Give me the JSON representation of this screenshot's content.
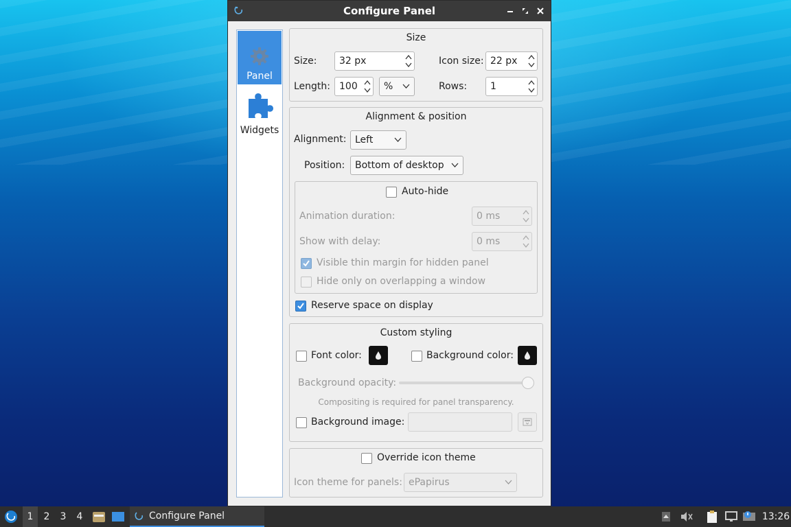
{
  "window": {
    "title": "Configure Panel",
    "controls": [
      "minimize-icon",
      "maximize-icon",
      "close-icon"
    ]
  },
  "sidebar": {
    "items": [
      {
        "label": "Panel",
        "icon": "gear-icon",
        "active": true
      },
      {
        "label": "Widgets",
        "icon": "puzzle-icon",
        "active": false
      }
    ]
  },
  "size_group": {
    "title": "Size",
    "size_label": "Size:",
    "size_value": "32 px",
    "icon_size_label": "Icon size:",
    "icon_size_value": "22 px",
    "length_label": "Length:",
    "length_value": "100",
    "length_unit": "%",
    "rows_label": "Rows:",
    "rows_value": "1"
  },
  "alignment_group": {
    "title": "Alignment & position",
    "alignment_label": "Alignment:",
    "alignment_value": "Left",
    "position_label": "Position:",
    "position_value": "Bottom of desktop",
    "autohide_label": "Auto-hide",
    "autohide_checked": false,
    "anim_label": "Animation duration:",
    "anim_value": "0 ms",
    "delay_label": "Show with delay:",
    "delay_value": "0 ms",
    "thin_margin_label": "Visible thin margin for hidden panel",
    "thin_margin_checked": true,
    "overlap_label": "Hide only on overlapping a window",
    "overlap_checked": false,
    "reserve_label": "Reserve space on display",
    "reserve_checked": true
  },
  "styling_group": {
    "title": "Custom styling",
    "font_color_label": "Font color:",
    "bg_color_label": "Background color:",
    "opacity_label": "Background opacity:",
    "opacity_value": 1.0,
    "compositing_note": "Compositing is required for panel transparency.",
    "bg_image_label": "Background image:",
    "bg_image_value": ""
  },
  "icon_theme_group": {
    "override_label": "Override icon theme",
    "theme_label": "Icon theme for panels:",
    "theme_value": "ePapirus"
  },
  "taskbar": {
    "workspaces": [
      "1",
      "2",
      "3",
      "4"
    ],
    "active_workspace": "1",
    "task_label": "Configure Panel",
    "clock": "13:26"
  },
  "colors": {
    "accent": "#3d8ee0",
    "titlebar": "#3a3a3a",
    "taskbar": "#2e2e2e"
  }
}
